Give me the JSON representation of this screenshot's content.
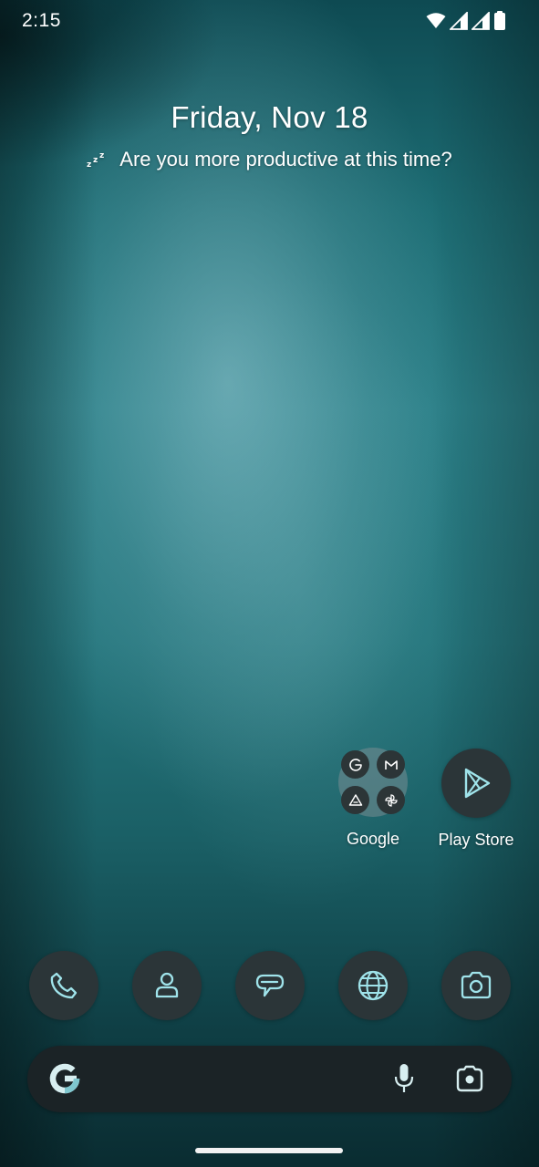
{
  "status_bar": {
    "time": "2:15",
    "icons": [
      "wifi-icon",
      "signal-icon",
      "signal-icon",
      "battery-icon"
    ]
  },
  "glance": {
    "date": "Friday, Nov 18",
    "prompt": "Are you more productive at this time?",
    "prompt_icon": "zzz-icon"
  },
  "home_apps": [
    {
      "label": "Google",
      "icon": "google-folder-icon",
      "folder_apps": [
        "google-icon",
        "gmail-icon",
        "drive-icon",
        "photos-icon"
      ]
    },
    {
      "label": "Play Store",
      "icon": "play-store-icon"
    }
  ],
  "dock": {
    "apps": [
      "phone-icon",
      "contacts-icon",
      "messages-icon",
      "browser-icon",
      "camera-icon"
    ]
  },
  "search_bar": {
    "logo": "google-g-icon",
    "voice_icon": "mic-icon",
    "lens_icon": "lens-icon"
  },
  "colors": {
    "icon_accent": "#9fe3ea",
    "icon_background": "#2b3538",
    "search_background": "#1b2326"
  }
}
